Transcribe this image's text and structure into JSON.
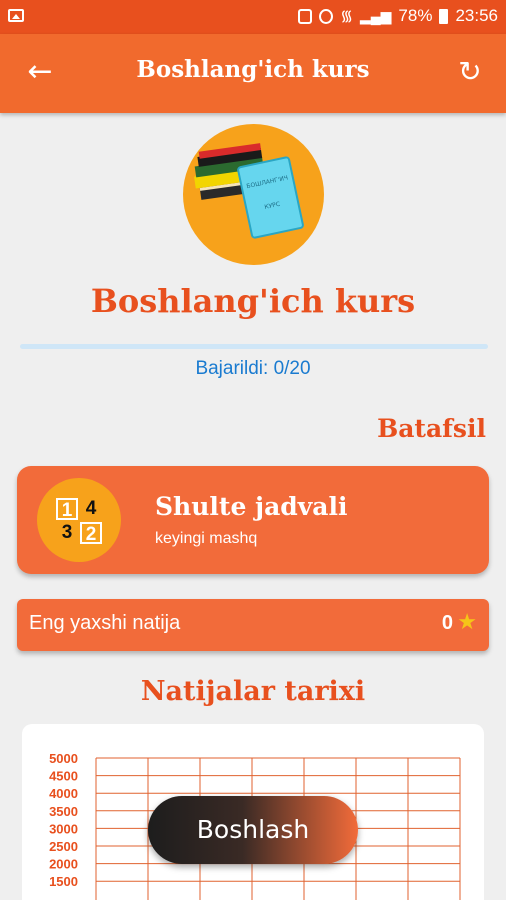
{
  "status_bar": {
    "battery": "78%",
    "time": "23:56"
  },
  "app_bar": {
    "title": "Boshlang'ich kurs"
  },
  "course": {
    "logo_texts": [
      "БОШЛАНГ'ИЧ",
      "КУРС"
    ],
    "title": "Boshlang'ich kurs",
    "progress_label": "Bajarildi: 0/20",
    "progress_fraction": 0.0
  },
  "details": {
    "label": "Batafsil"
  },
  "exercise": {
    "name": "Shulte jadvali",
    "subtitle": "keyingi mashq",
    "icon_numbers": [
      "1",
      "4",
      "3",
      "2"
    ]
  },
  "best_result": {
    "label": "Eng yaxshi natija",
    "value": "0"
  },
  "history": {
    "title": "Natijalar tarixi"
  },
  "chart_data": {
    "type": "line",
    "title": "",
    "xlabel": "",
    "ylabel": "",
    "y_ticks": [
      5000,
      4500,
      4000,
      3500,
      3000,
      2500,
      2000,
      1500
    ],
    "ylim": [
      1500,
      5000
    ],
    "x": [],
    "series": [],
    "grid": true,
    "colors": {
      "grid": "#e0622f",
      "tick_label": "#e8501e"
    }
  },
  "start_button": {
    "label": "Boshlash"
  }
}
